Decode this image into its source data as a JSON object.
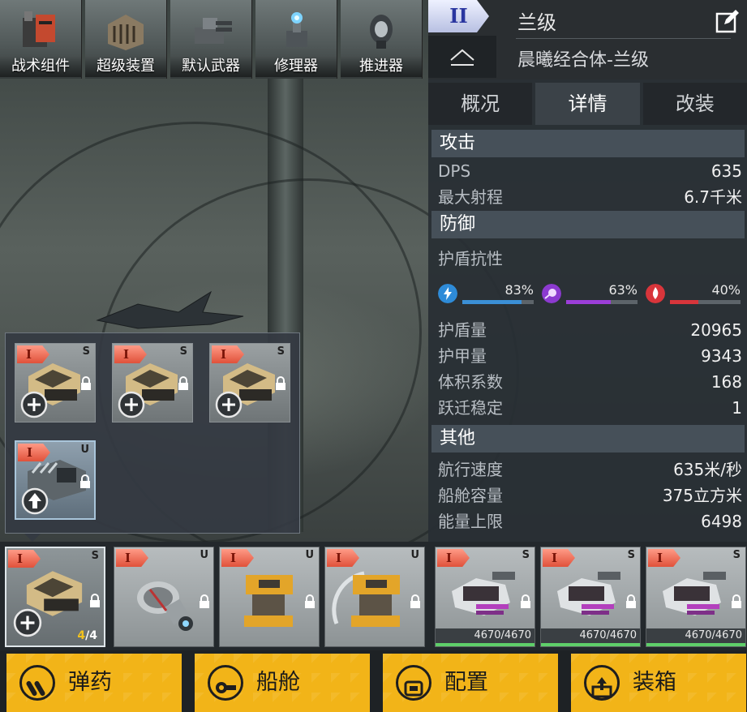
{
  "module_tabs": [
    {
      "label": "战术组件",
      "icon": "tactical-component-icon"
    },
    {
      "label": "超级装置",
      "icon": "super-device-icon"
    },
    {
      "label": "默认武器",
      "icon": "default-weapon-icon"
    },
    {
      "label": "修理器",
      "icon": "repairer-icon"
    },
    {
      "label": "推进器",
      "icon": "thruster-icon"
    }
  ],
  "ship": {
    "tier": "II",
    "class": "兰级",
    "name": "晨曦经合体-兰级"
  },
  "tabs": [
    {
      "label": "概况",
      "active": false
    },
    {
      "label": "详情",
      "active": true
    },
    {
      "label": "改装",
      "active": false
    }
  ],
  "attack": {
    "title": "攻击",
    "dps_label": "DPS",
    "dps_value": "635",
    "range_label": "最大射程",
    "range_value": "6.7千米"
  },
  "defense": {
    "title": "防御",
    "shield_resist_label": "护盾抗性",
    "resist": [
      {
        "type": "electric",
        "icon": "lightning-icon",
        "percent": "83%",
        "value": 0.83,
        "color": "#3b8fd6"
      },
      {
        "type": "energy",
        "icon": "energy-orb-icon",
        "percent": "63%",
        "value": 0.63,
        "color": "#9b3ed8"
      },
      {
        "type": "thermal",
        "icon": "flame-icon",
        "percent": "40%",
        "value": 0.4,
        "color": "#d8353b"
      }
    ],
    "rows": [
      {
        "label": "护盾量",
        "value": "20965"
      },
      {
        "label": "护甲量",
        "value": "9343"
      },
      {
        "label": "体积系数",
        "value": "168"
      },
      {
        "label": "跃迁稳定",
        "value": "1"
      }
    ]
  },
  "other": {
    "title": "其他",
    "rows": [
      {
        "label": "航行速度",
        "value": "635米/秒"
      },
      {
        "label": "船舱容量",
        "value": "375立方米"
      },
      {
        "label": "能量上限",
        "value": "6498"
      }
    ]
  },
  "popup_slots": [
    {
      "tier": "I",
      "type": "S",
      "action": "add"
    },
    {
      "tier": "I",
      "type": "S",
      "action": "add"
    },
    {
      "tier": "I",
      "type": "S",
      "action": "add"
    },
    {
      "tier": "I",
      "type": "U",
      "action": "upgrade"
    }
  ],
  "equip_slots": [
    {
      "tier": "I",
      "type": "S",
      "count_current": "4",
      "count_total": "/4"
    },
    {
      "tier": "I",
      "type": "U"
    },
    {
      "tier": "I",
      "type": "U"
    },
    {
      "tier": "I",
      "type": "U"
    },
    {
      "tier": "I",
      "type": "S",
      "hp": "4670/4670"
    },
    {
      "tier": "I",
      "type": "S",
      "hp": "4670/4670"
    },
    {
      "tier": "I",
      "type": "S",
      "hp": "4670/4670"
    }
  ],
  "actions": [
    {
      "label": "弹药",
      "icon": "ammo-icon"
    },
    {
      "label": "船舱",
      "icon": "cargo-icon"
    },
    {
      "label": "配置",
      "icon": "loadout-icon"
    },
    {
      "label": "装箱",
      "icon": "pack-icon"
    }
  ]
}
